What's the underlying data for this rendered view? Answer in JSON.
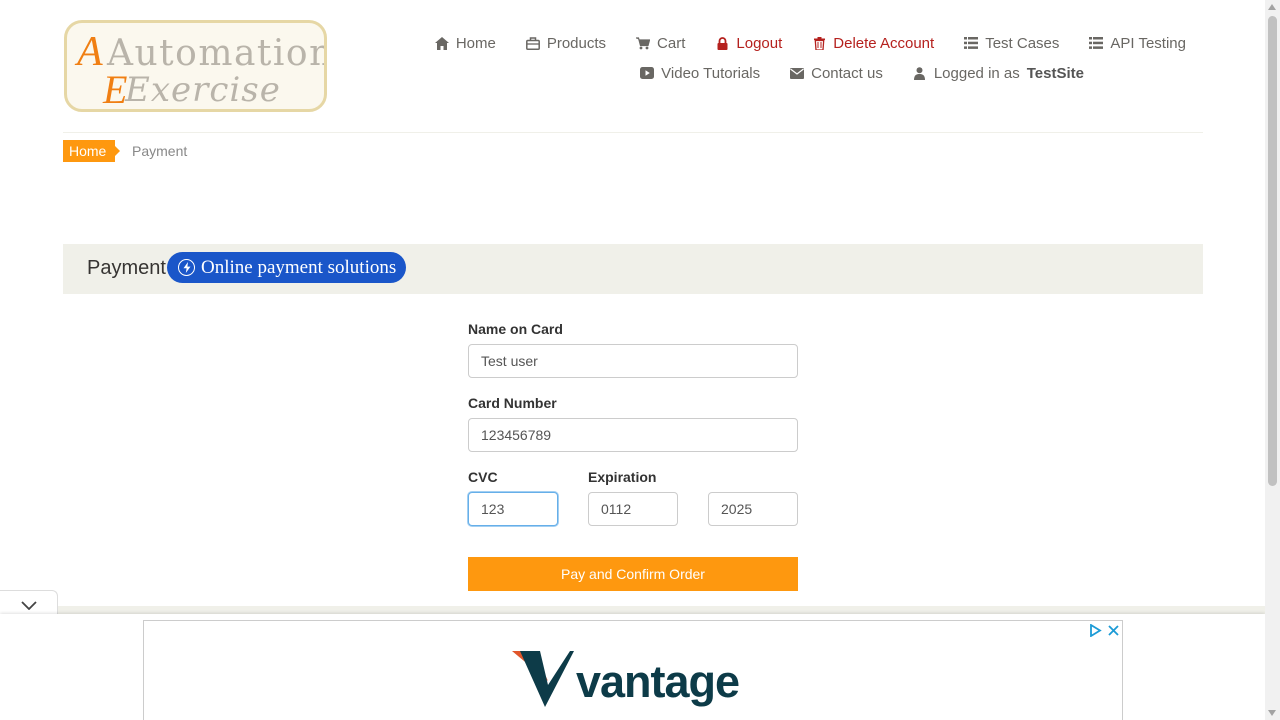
{
  "logo": {
    "line1": "Automation",
    "line2": "Exercise"
  },
  "nav": {
    "row1": [
      {
        "label": "Home",
        "icon": "home-icon"
      },
      {
        "label": "Products",
        "icon": "products-icon"
      },
      {
        "label": "Cart",
        "icon": "cart-icon"
      },
      {
        "label": "Logout",
        "icon": "lock-icon"
      },
      {
        "label": "Delete Account",
        "icon": "trash-icon"
      },
      {
        "label": "Test Cases",
        "icon": "list-icon"
      },
      {
        "label": "API Testing",
        "icon": "list-icon"
      }
    ],
    "row2": [
      {
        "label": "Video Tutorials",
        "icon": "video-icon"
      },
      {
        "label": "Contact us",
        "icon": "envelope-icon"
      },
      {
        "label": "Logged in as",
        "icon": "user-icon",
        "user": "TestSite"
      }
    ]
  },
  "breadcrumb": {
    "home": "Home",
    "current": "Payment"
  },
  "payment": {
    "title": "Payment",
    "badge": "Online payment solutions"
  },
  "form": {
    "name_label": "Name on Card",
    "name_value": "Test user",
    "card_label": "Card Number",
    "card_value": "123456789",
    "cvc_label": "CVC",
    "cvc_value": "123",
    "expiry_label": "Expiration",
    "expiry_month": "0112",
    "expiry_year": "2025",
    "submit_label": "Pay and Confirm Order"
  },
  "ad": {
    "brand": "vantage"
  },
  "colors": {
    "accent": "#FE980F",
    "danger": "#B5211E",
    "badge": "#1A56C9",
    "bar": "#F0F0E9"
  }
}
